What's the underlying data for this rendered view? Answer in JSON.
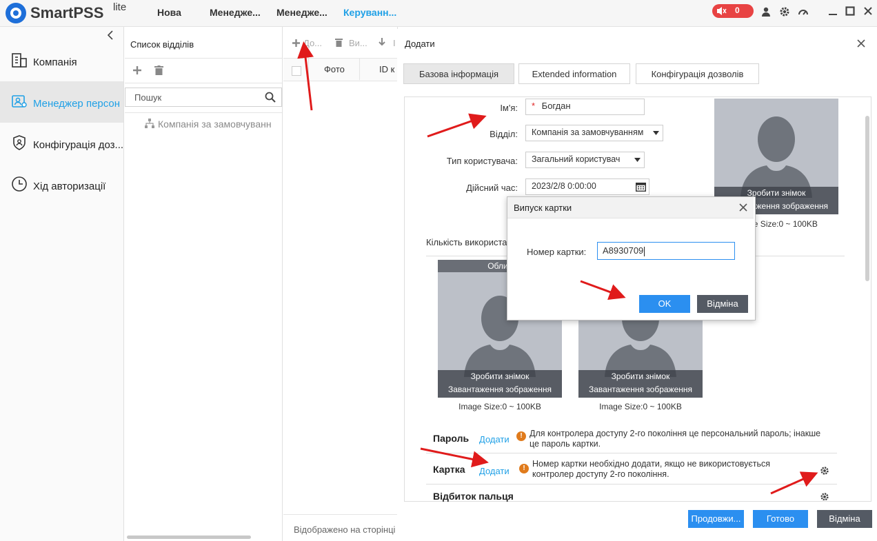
{
  "app": {
    "name": "SmartPSS",
    "superscript": "lite"
  },
  "top_tabs": [
    "Нова",
    "Менедже...",
    "Менедже...",
    "Керуванн..."
  ],
  "alarm_count": "0",
  "sidebar": {
    "items": [
      {
        "label": "Компанія"
      },
      {
        "label": "Менеджер персон"
      },
      {
        "label": "Конфігурація доз..."
      },
      {
        "label": "Хід авторизації"
      }
    ]
  },
  "dept_panel": {
    "title": "Список відділів",
    "search_placeholder": "Пошук",
    "tree_root": "Компанія за замовчуванн"
  },
  "person_list": {
    "toolbar": {
      "add": "До...",
      "delete": "Ви...",
      "import": "I"
    },
    "columns": [
      "Фото",
      "ID к"
    ],
    "footer": "Відображено на сторінці"
  },
  "add_dialog": {
    "title": "Додати",
    "tabs": [
      "Базова інформація",
      "Extended information",
      "Конфігурація дозволів"
    ],
    "fields": {
      "name_label": "Ім'я:",
      "name_value": "Богдан",
      "dept_label": "Відділ:",
      "dept_value": "Компанія за замовчуванням",
      "usertype_label": "Тип користувача:",
      "usertype_value": "Загальний користувач",
      "valid_label": "Дійсний час:",
      "valid_value": "2023/2/8 0:00:00"
    },
    "photo_main": {
      "take": "Зробити знімок",
      "upload": "Завантаження зображення",
      "size": "Image Size:0 ~ 100KB"
    },
    "users_label": "Кількість використа",
    "face_label": "Облич",
    "photo_face1": {
      "take": "Зробити знімок",
      "upload": "Завантаження зображення",
      "size": "Image Size:0 ~ 100KB"
    },
    "photo_face2": {
      "take": "Зробити знімок",
      "upload": "Завантаження зображення",
      "size": "Image Size:0 ~ 100KB"
    },
    "password": {
      "title": "Пароль",
      "add": "Додати",
      "note1": "Для контролера доступу 2-го покоління це персональний пароль; інакше",
      "note2": "це пароль картки."
    },
    "card": {
      "title": "Картка",
      "add": "Додати",
      "note1": "Номер картки необхідно додати, якщо не використовується",
      "note2": "контролер доступу 2-го покоління."
    },
    "fingerprint": {
      "title": "Відбиток пальця"
    },
    "buttons": {
      "continue": "Продовжи...",
      "done": "Готово",
      "cancel": "Відміна"
    }
  },
  "card_dialog": {
    "title": "Випуск картки",
    "number_label": "Номер картки:",
    "number_value": "A8930709",
    "ok": "OK",
    "cancel": "Відміна"
  },
  "colors": {
    "accent": "#1fa0e6",
    "button_blue": "#2b8ff0",
    "button_dark": "#545a64",
    "alarm_red": "#e84343",
    "annotation_arrow": "#e01b1b"
  }
}
